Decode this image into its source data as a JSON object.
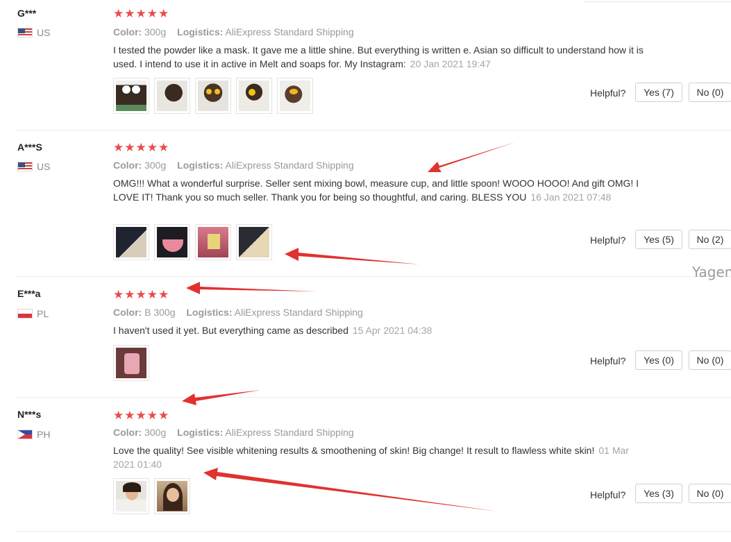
{
  "labels": {
    "color": "Color:",
    "logistics": "Logistics:",
    "helpful": "Helpful?"
  },
  "watermark": "Yagen",
  "reviews": [
    {
      "user": "G***",
      "country": "US",
      "rating": 5,
      "stars": "★★★★★",
      "color_value": "300g",
      "logistics_value": "AliExpress Standard Shipping",
      "text": "I tested the powder like a mask. It gave me a little shine. But everything is written e. Asian so difficult to understand how it is used. I intend to use it in active in Melt and soaps for. My Instagram:",
      "date": "20 Jan 2021 19:47",
      "photo_count": 5,
      "yes": "Yes (7)",
      "no": "No (0)"
    },
    {
      "user": "A***S",
      "country": "US",
      "rating": 5,
      "stars": "★★★★★",
      "color_value": "300g",
      "logistics_value": "AliExpress Standard Shipping",
      "text": "OMG!!! What a wonderful surprise. Seller sent mixing bowl, measure cup, and little spoon! WOOO HOOO! And gift OMG! I LOVE IT! Thank you so much seller. Thank you for being so thoughtful, and caring. BLESS YOU",
      "date": "16 Jan 2021 07:48",
      "photo_count": 4,
      "yes": "Yes (5)",
      "no": "No (2)"
    },
    {
      "user": "E***a",
      "country": "PL",
      "rating": 5,
      "stars": "★★★★★",
      "color_value": "B 300g",
      "logistics_value": "AliExpress Standard Shipping",
      "text": "I haven't used it yet. But everything came as described",
      "date": "15 Apr 2021 04:38",
      "photo_count": 1,
      "yes": "Yes (0)",
      "no": "No (0)"
    },
    {
      "user": "N***s",
      "country": "PH",
      "rating": 5,
      "stars": "★★★★★",
      "color_value": "300g",
      "logistics_value": "AliExpress Standard Shipping",
      "text": "Love the quality! See visible whitening results & smoothening of skin! Big change! It result to flawless white skin!",
      "date": "01 Mar 2021 01:40",
      "photo_count": 2,
      "yes": "Yes (3)",
      "no": "No (0)"
    }
  ],
  "colors": {
    "star": "#e94b4b",
    "arrow": "#e0322f",
    "muted_text": "#9a9a9a",
    "divider": "#ececec"
  }
}
